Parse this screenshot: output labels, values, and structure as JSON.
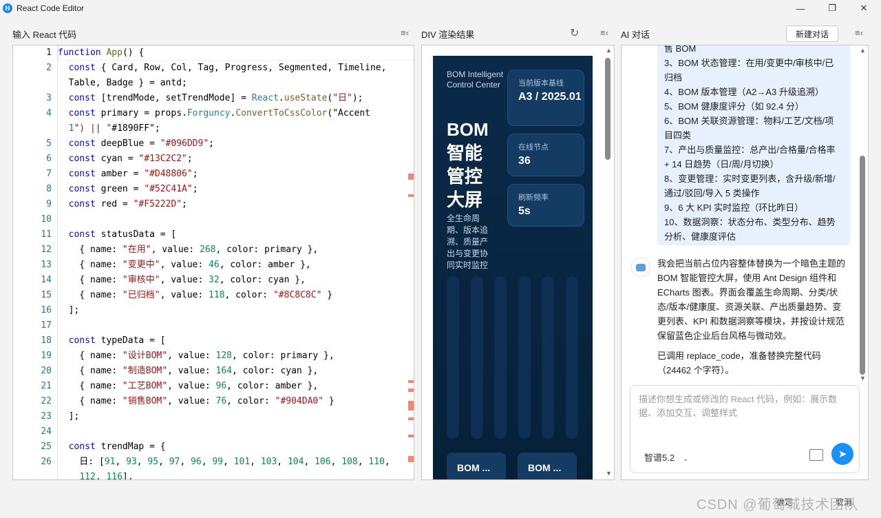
{
  "window": {
    "title": "React Code Editor",
    "app_icon": "H",
    "controls": [
      "—",
      "❐",
      "✕"
    ]
  },
  "editor": {
    "header": "输入 React 代码",
    "lines": [
      {
        "n": "1",
        "text": "function App() {"
      },
      {
        "n": "2",
        "text": "  const { Card, Row, Col, Tag, Progress, Segmented, Timeline,"
      },
      {
        "n": "",
        "text": "  Table, Badge } = antd;"
      },
      {
        "n": "3",
        "text": "  const [trendMode, setTrendMode] = React.useState(\"日\");"
      },
      {
        "n": "4",
        "text": "  const primary = props.Forguncy.ConvertToCssColor(\"Accent"
      },
      {
        "n": "",
        "text": "  1\") || \"#1890FF\";"
      },
      {
        "n": "5",
        "text": "  const deepBlue = \"#096DD9\";"
      },
      {
        "n": "6",
        "text": "  const cyan = \"#13C2C2\";"
      },
      {
        "n": "7",
        "text": "  const amber = \"#D48806\";"
      },
      {
        "n": "8",
        "text": "  const green = \"#52C41A\";"
      },
      {
        "n": "9",
        "text": "  const red = \"#F5222D\";"
      },
      {
        "n": "10",
        "text": ""
      },
      {
        "n": "11",
        "text": "  const statusData = ["
      },
      {
        "n": "12",
        "text": "    { name: \"在用\", value: 268, color: primary },"
      },
      {
        "n": "13",
        "text": "    { name: \"变更中\", value: 46, color: amber },"
      },
      {
        "n": "14",
        "text": "    { name: \"审核中\", value: 32, color: cyan },"
      },
      {
        "n": "15",
        "text": "    { name: \"已归档\", value: 118, color: \"#8C8C8C\" }"
      },
      {
        "n": "16",
        "text": "  ];"
      },
      {
        "n": "17",
        "text": ""
      },
      {
        "n": "18",
        "text": "  const typeData = ["
      },
      {
        "n": "19",
        "text": "    { name: \"设计BOM\", value: 128, color: primary },"
      },
      {
        "n": "20",
        "text": "    { name: \"制造BOM\", value: 164, color: cyan },"
      },
      {
        "n": "21",
        "text": "    { name: \"工艺BOM\", value: 96, color: amber },"
      },
      {
        "n": "22",
        "text": "    { name: \"销售BOM\", value: 76, color: \"#904DA0\" }"
      },
      {
        "n": "23",
        "text": "  ];"
      },
      {
        "n": "24",
        "text": ""
      },
      {
        "n": "25",
        "text": "  const trendMap = {"
      },
      {
        "n": "26",
        "text": "    日: [91, 93, 95, 97, 96, 99, 101, 103, 104, 106, 108, 110,"
      },
      {
        "n": "",
        "text": "    112, 116],"
      }
    ]
  },
  "preview": {
    "header": "DIV 渲染结果",
    "screen": {
      "small_title": "BOM Intelligent Control Center",
      "big_title": "BOM 智能 管控 大屏",
      "description": "全生命周期、版本追溯、质量产出与变更协同实时监控",
      "cards": [
        {
          "label": "当前版本基线",
          "value": "A3 / 2025.01"
        },
        {
          "label": "在线节点",
          "value": "36"
        },
        {
          "label": "刷新频率",
          "value": "5s"
        }
      ],
      "bottom_cards": [
        "BOM ...",
        "BOM ..."
      ]
    }
  },
  "chat": {
    "header": "AI 对话",
    "new_chat_label": "新建对话",
    "user_message_lines": [
      "售 BOM",
      "3、BOM 状态管理：在用/变更中/审核中/已",
      "归档",
      "4、BOM 版本管理（A2→A3 升级追溯）",
      "5、BOM 健康度评分（如 92.4 分）",
      "6、BOM 关联资源管理：物料/工艺/文档/项",
      "目四类",
      "7、产出与质量监控：总产出/合格量/合格率",
      "+ 14 日趋势（日/周/月切换）",
      "8、变更管理：实时变更列表，含升级/新增/",
      "通过/驳回/导入 5 类操作",
      "9、6 大 KPI 实时监控（环比昨日）",
      "10、数据洞察：状态分布、类型分布、趋势",
      "分析、健康度评估"
    ],
    "bot_message_lines": [
      "我会把当前占位内容整体替换为一个暗色主题的",
      "BOM 智能管控大屏，使用 Ant Design 组件和",
      "ECharts 图表。界面会覆盖生命周期、分类/状",
      "态/版本/健康度、资源关联、产出质量趋势、变",
      "更列表、KPI 和数据洞察等模块，并按设计规范",
      "保留蓝色企业后台风格与微动效。"
    ],
    "bot_status_lines": [
      "已调用 replace_code，准备替换完整代码",
      "（24462 个字符）。"
    ],
    "input_placeholder": "描述你想生成或修改的 React 代码，例如：展示数据、添加交互、调整样式",
    "model": "智谱5.2",
    "accent": "#1890ff"
  },
  "footer": {
    "confirm_label": "确定",
    "cancel_label": "取消",
    "watermark": "CSDN @葡萄城技术团队"
  }
}
